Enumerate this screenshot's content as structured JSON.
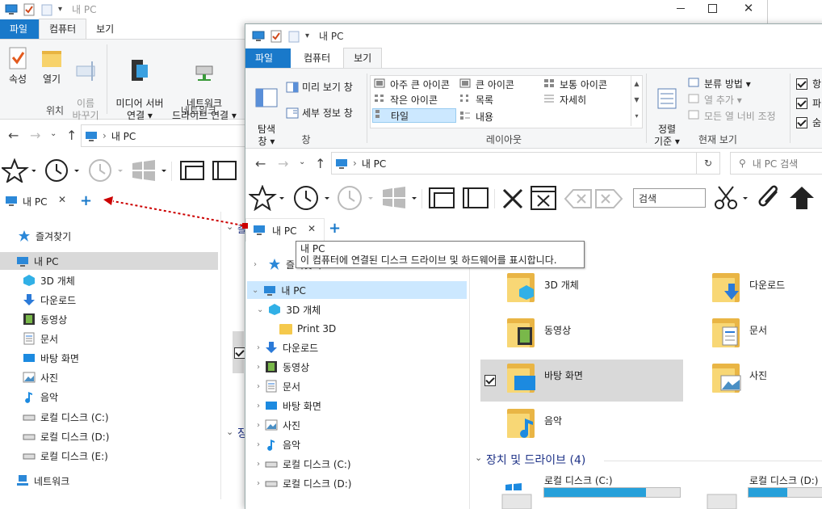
{
  "back_window": {
    "title": "내 PC",
    "tabs": [
      "파일",
      "컴퓨터",
      "보기"
    ],
    "ribbon": {
      "buttons": [
        {
          "label": "속성"
        },
        {
          "label": "열기"
        },
        {
          "label": "이름\n바꾸기"
        },
        {
          "label": "미디어 서버\n연결 ▾"
        },
        {
          "label": "네트워크\n드라이브 연결 ▾"
        }
      ],
      "groups": [
        "위치",
        "네트워크"
      ]
    },
    "address": "내 PC",
    "tab_label": "내 PC",
    "new_tab": "+",
    "nav": [
      {
        "label": "즐겨찾기",
        "icon": "star-icon"
      },
      {
        "label": "내 PC",
        "icon": "pc-icon"
      },
      {
        "label": "3D 개체",
        "icon": "3d-objects-icon"
      },
      {
        "label": "다운로드",
        "icon": "download-icon"
      },
      {
        "label": "동영상",
        "icon": "video-icon"
      },
      {
        "label": "문서",
        "icon": "document-icon"
      },
      {
        "label": "바탕 화면",
        "icon": "desktop-icon"
      },
      {
        "label": "사진",
        "icon": "picture-icon"
      },
      {
        "label": "음악",
        "icon": "music-icon"
      },
      {
        "label": "로컬 디스크 (C:)",
        "icon": "drive-icon"
      },
      {
        "label": "로컬 디스크 (D:)",
        "icon": "drive-icon"
      },
      {
        "label": "로컬 디스크 (E:)",
        "icon": "drive-icon"
      },
      {
        "label": "네트워크",
        "icon": "network-icon"
      }
    ],
    "partial_text": [
      "즐",
      "장"
    ]
  },
  "front_window": {
    "title": "내 PC",
    "tabs": [
      "파일",
      "컴퓨터",
      "보기"
    ],
    "ribbon": {
      "pane_buttons": [
        "탐색\n창 ▾",
        "미리 보기 창",
        "세부 정보 창"
      ],
      "layout": [
        "아주 큰 아이콘",
        "큰 아이콘",
        "보통 아이콘",
        "작은 아이콘",
        "목록",
        "자세히",
        "타일",
        "내용"
      ],
      "sort_button": "정렬\n기준 ▾",
      "view_items": [
        "분류 방법 ▾",
        "열 추가 ▾",
        "모든 열 너비 조정"
      ],
      "checkbox_labels": [
        "항",
        "파",
        "숨"
      ],
      "groups": [
        "창",
        "레이아웃",
        "현재 보기"
      ]
    },
    "address": "내 PC",
    "search_placeholder": "내 PC 검색",
    "toolbar_search": "검색",
    "tab_label": "내 PC",
    "new_tab": "+",
    "tooltip": {
      "title": "내 PC",
      "body": "이 컴퓨터에 연결된 디스크 드라이브 및 하드웨어를 표시합니다."
    },
    "nav": [
      {
        "label": "즐겨찾기"
      },
      {
        "label": "내 PC"
      },
      {
        "label": "3D 개체"
      },
      {
        "label": "Print 3D"
      },
      {
        "label": "다운로드"
      },
      {
        "label": "동영상"
      },
      {
        "label": "문서"
      },
      {
        "label": "바탕 화면"
      },
      {
        "label": "사진"
      },
      {
        "label": "음악"
      },
      {
        "label": "로컬 디스크 (C:)"
      },
      {
        "label": "로컬 디스크 (D:)"
      }
    ],
    "folders": [
      {
        "label": "3D 개체"
      },
      {
        "label": "다운로드"
      },
      {
        "label": "동영상"
      },
      {
        "label": "문서"
      },
      {
        "label": "바탕 화면"
      },
      {
        "label": "사진"
      },
      {
        "label": "음악"
      }
    ],
    "devices_header": "장치 및 드라이브 (4)",
    "drives": [
      {
        "label": "로컬 디스크 (C:)",
        "used_fraction": 0.75
      },
      {
        "label": "로컬 디스크 (D:)",
        "used_fraction": 0.5
      }
    ]
  },
  "colors": {
    "accent": "#1979ca",
    "selection": "#cce8ff",
    "drag_arrow": "#cc0000"
  }
}
